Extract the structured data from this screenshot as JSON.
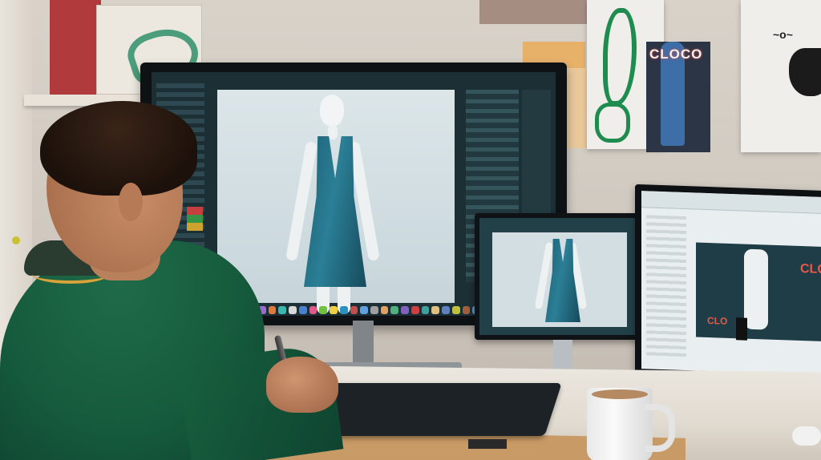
{
  "scene": {
    "description_colors": {
      "wall": "#d8d2c9",
      "desk": "#ece7df",
      "shirt": "#155a3c",
      "dress": "#1d5f74"
    }
  },
  "posters": {
    "fashion_logo": "CLOCO",
    "right_logo": "CLO",
    "right_logo_small": "CLO"
  },
  "main_monitor": {
    "dock_colors": [
      "#e04b4b",
      "#3aa0e0",
      "#f0b030",
      "#5ac06a",
      "#9b6bd0",
      "#e07a3a",
      "#3ab8b0",
      "#d8d8d8",
      "#4a80d0",
      "#e05a8a",
      "#70c040",
      "#f0d040",
      "#2a90c0",
      "#c05050",
      "#60a0e0",
      "#a0a0a0",
      "#e0a060",
      "#50b080",
      "#8060c0",
      "#d04040",
      "#40a0a0",
      "#e0c080",
      "#6080c0",
      "#c0c040",
      "#a06040",
      "#5090d0"
    ]
  }
}
